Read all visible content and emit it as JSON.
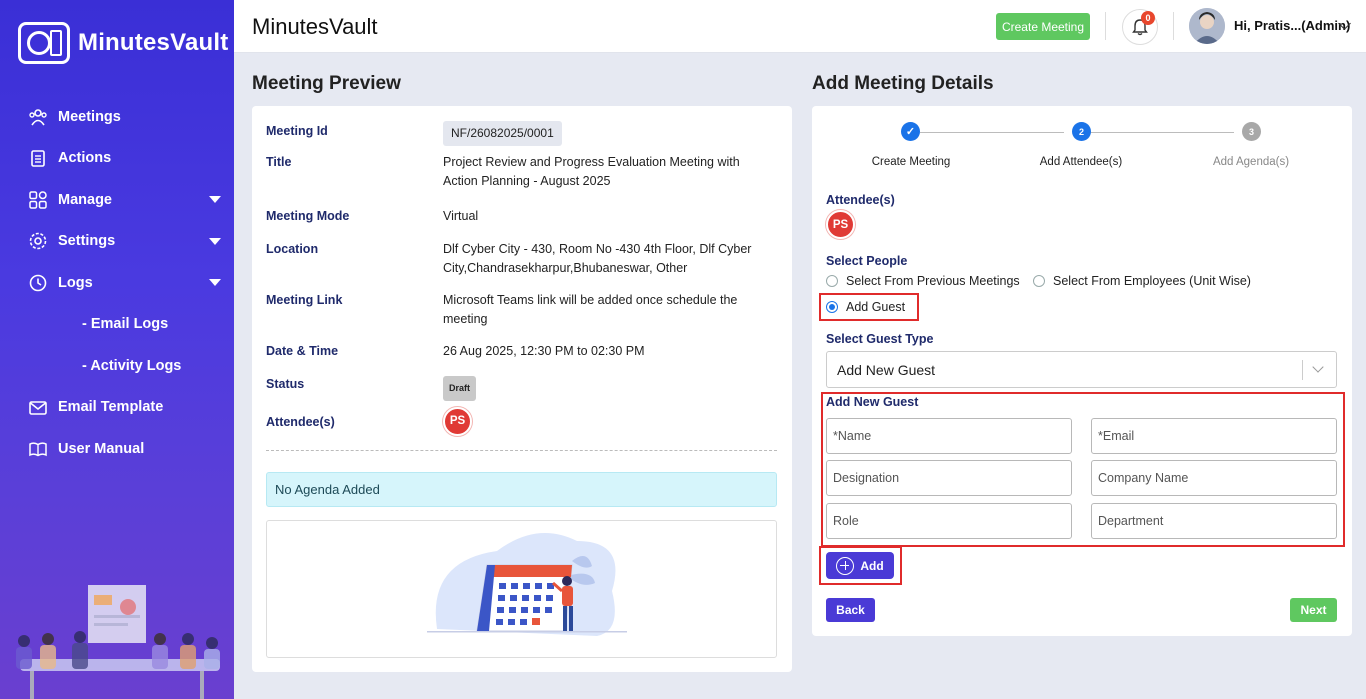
{
  "brand": {
    "name": "MinutesVault"
  },
  "sidebar": {
    "items": [
      {
        "label": "Meetings",
        "icon": "users-icon"
      },
      {
        "label": "Actions",
        "icon": "clipboard-icon"
      },
      {
        "label": "Manage",
        "icon": "grid-icon",
        "has_submenu": true
      },
      {
        "label": "Settings",
        "icon": "gear-icon",
        "has_submenu": true
      },
      {
        "label": "Logs",
        "icon": "history-icon",
        "has_submenu": true
      },
      {
        "label": "- Email Logs"
      },
      {
        "label": "- Activity Logs"
      },
      {
        "label": "Email Template",
        "icon": "mail-icon"
      },
      {
        "label": "User Manual",
        "icon": "book-icon"
      }
    ]
  },
  "header": {
    "title": "MinutesVault",
    "create_button": "Create Meeting",
    "notifications_count": "0",
    "user_name": "Hi, Pratis...(Admin)"
  },
  "preview": {
    "title": "Meeting Preview",
    "fields": {
      "meeting_id": {
        "label": "Meeting Id",
        "value": "NF/26082025/0001"
      },
      "title": {
        "label": "Title",
        "value": "Project Review and Progress Evaluation Meeting with Action Planning - August 2025"
      },
      "mode": {
        "label": "Meeting Mode",
        "value": "Virtual"
      },
      "location": {
        "label": "Location",
        "value": "Dlf Cyber City - 430, Room No -430 4th Floor, Dlf Cyber City,Chandrasekharpur,Bhubaneswar, Other"
      },
      "link": {
        "label": "Meeting Link",
        "value": "Microsoft Teams link will be added once schedule the meeting"
      },
      "datetime": {
        "label": "Date & Time",
        "value": "26 Aug 2025, 12:30 PM to 02:30 PM"
      },
      "status": {
        "label": "Status",
        "value": "Draft"
      },
      "attendees": {
        "label": "Attendee(s)",
        "value": "PS"
      }
    },
    "agenda_message": "No Agenda Added"
  },
  "details": {
    "title": "Add Meeting Details",
    "steps": [
      {
        "label": "Create Meeting",
        "marker": "✓",
        "state": "done"
      },
      {
        "label": "Add Attendee(s)",
        "marker": "2",
        "state": "active"
      },
      {
        "label": "Add Agenda(s)",
        "marker": "3",
        "state": "pending"
      }
    ],
    "attendees_label": "Attendee(s)",
    "attendee_initials": "PS",
    "select_people_label": "Select People",
    "options": {
      "previous": "Select From Previous Meetings",
      "employees": "Select From Employees (Unit Wise)",
      "guest": "Add Guest"
    },
    "selected_option": "Add Guest",
    "guest_type_label": "Select Guest Type",
    "guest_type_value": "Add New Guest",
    "new_guest_label": "Add New Guest",
    "fields": {
      "name": "*Name",
      "email": "*Email",
      "designation": "Designation",
      "company": "Company Name",
      "role": "Role",
      "department": "Department"
    },
    "add_button": "Add",
    "back_button": "Back",
    "next_button": "Next"
  },
  "colors": {
    "sidebar": "#4a3ae0",
    "primary": "#4a3ad6",
    "success": "#5fc860",
    "label": "#1f2a6b",
    "highlight": "#e02b2b"
  }
}
